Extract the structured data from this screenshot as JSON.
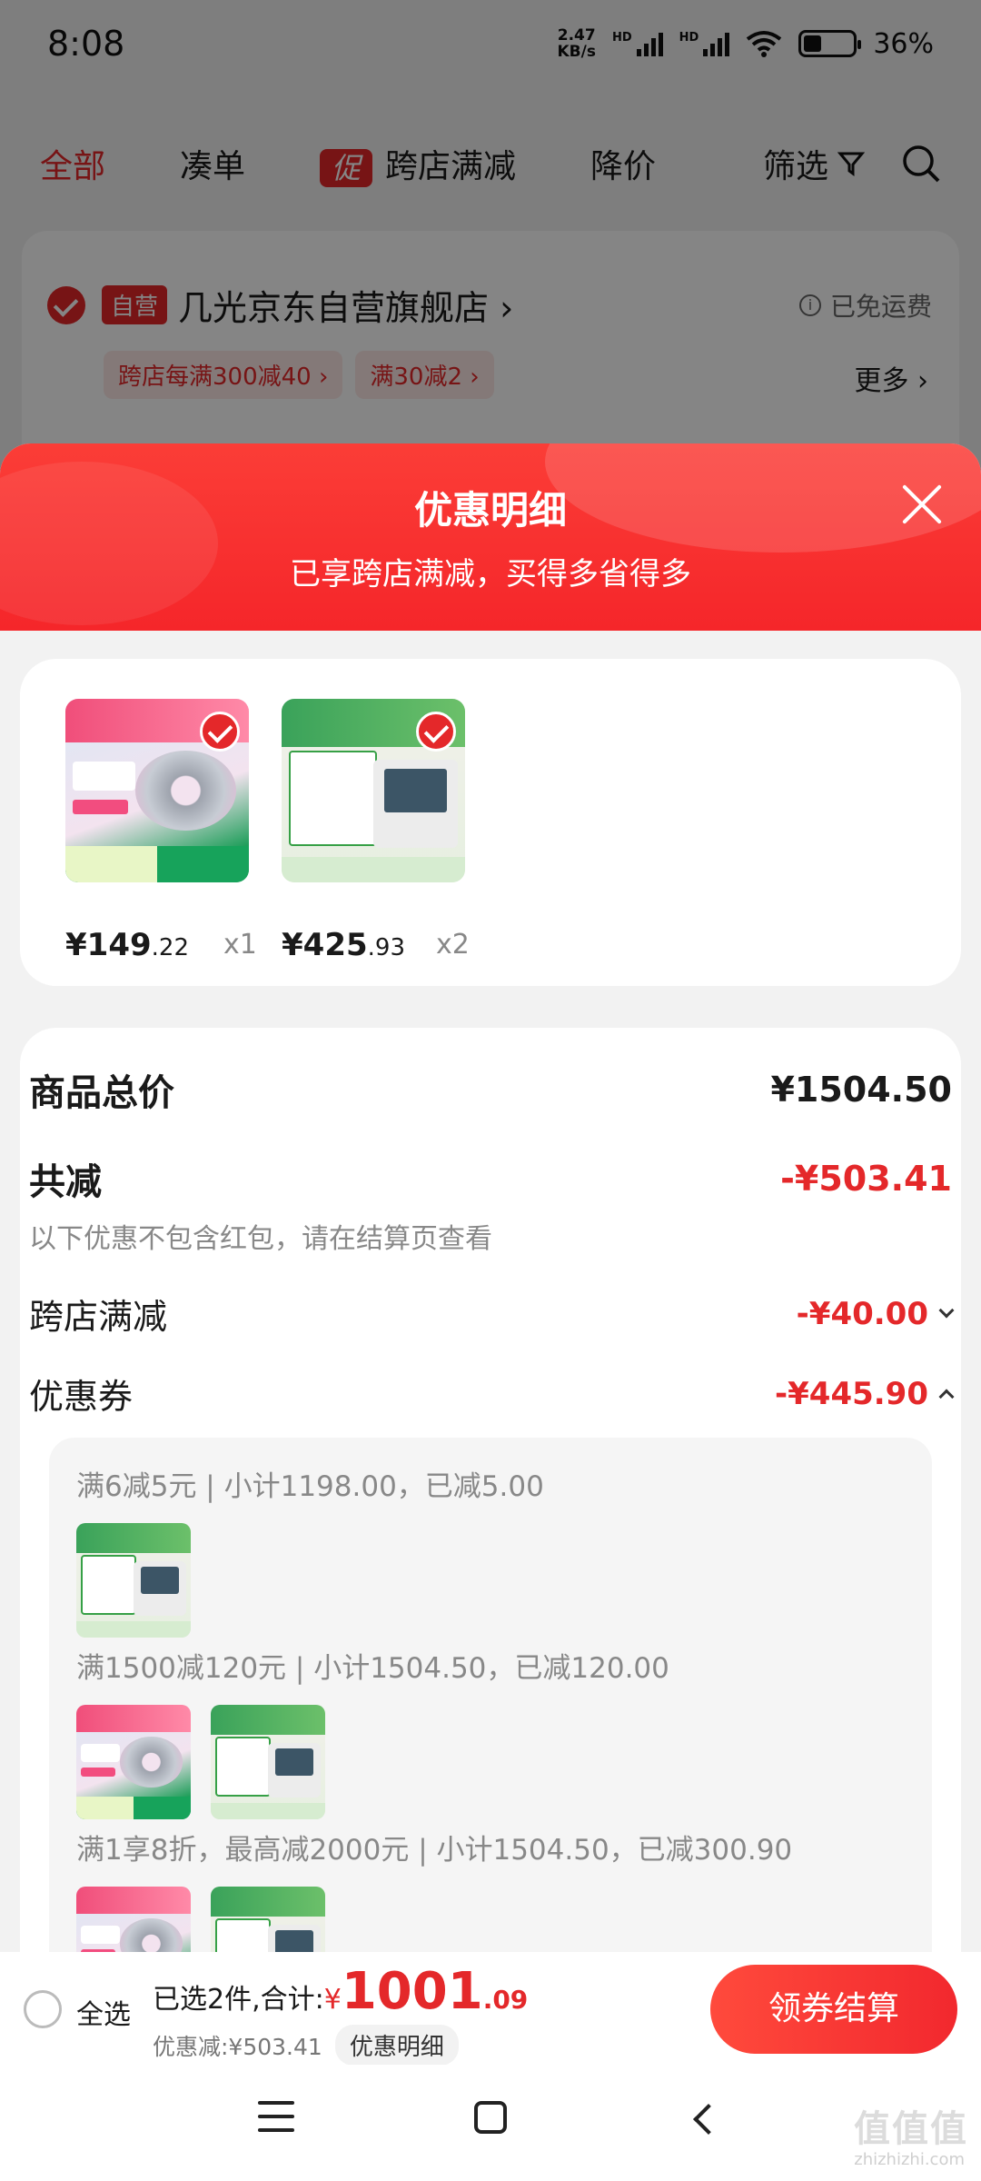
{
  "status_bar": {
    "time": "8:08",
    "net_speed_value": "2.47",
    "net_speed_unit": "KB/s",
    "hd1": "HD",
    "hd2": "HD",
    "battery": "36%"
  },
  "tabs": {
    "all": "全部",
    "combine": "凑单",
    "promo_badge": "促",
    "cross_store": "跨店满减",
    "price_drop": "降价",
    "filter": "筛选"
  },
  "store": {
    "self_badge": "自营",
    "name": "几光京东自营旗舰店 ›",
    "free_shipping": "已免运费",
    "info_icon_glyph": "i",
    "tags": [
      "跨店每满300减40 ›",
      "满30减2 ›"
    ],
    "more": "更多 ›"
  },
  "sheet": {
    "title": "优惠明细",
    "subtitle": "已享跨店满减，买得多省得多",
    "items": [
      {
        "name": "speaker",
        "price_main": "¥149",
        "price_dec": ".22",
        "qty": "x1"
      },
      {
        "name": "smart-screen",
        "price_main": "¥425",
        "price_dec": ".93",
        "qty": "x2"
      }
    ],
    "total_label": "商品总价",
    "total_value": "¥1504.50",
    "reduce_label": "共减",
    "reduce_value": "-¥503.41",
    "note": "以下优惠不包含红包，请在结算页查看",
    "cross_label": "跨店满减",
    "cross_value": "-¥40.00",
    "coupon_label": "优惠券",
    "coupon_value": "-¥445.90",
    "coupons": [
      "满6减5元 | 小计1198.00，已减5.00",
      "满1500减120元 | 小计1504.50，已减120.00",
      "满1享8折，最高减2000元 | 小计1504.50，已减300.90"
    ]
  },
  "bottom_bar": {
    "select_all": "全选",
    "selected_text": "已选2件,合计:",
    "currency": "¥",
    "total_int": "1001",
    "total_dec": ".09",
    "discount_text": "优惠减:¥503.41",
    "detail_pill": "优惠明细",
    "checkout": "领券结算"
  },
  "watermark": {
    "main": "值值值",
    "sub": "zhizhizhi.com"
  },
  "colors": {
    "accent": "#e4282a",
    "sheet_header": "#f5262a"
  }
}
